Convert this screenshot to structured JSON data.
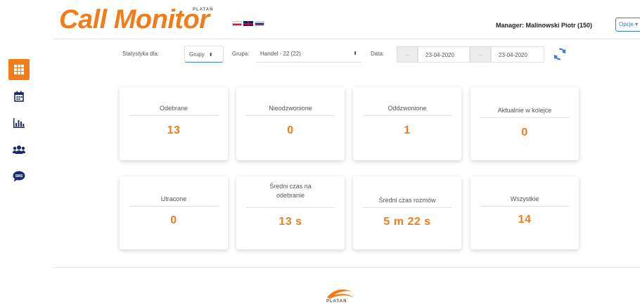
{
  "header": {
    "logo_text": "Call Monitor",
    "logo_sup": "PLATAN",
    "flags": [
      "pl-flag",
      "gb-flag",
      "ru-flag"
    ],
    "manager": "Manager: Malinowski Piotr (150)",
    "options_label": "Opcje ▾"
  },
  "filters": {
    "stats_for_label": "Statystyka dla:",
    "stats_for_value": "Grupy",
    "group_label": "Grupa:",
    "group_value": "Handel - 22 (22)",
    "date_label": "Data:",
    "date_btn": "...",
    "date_from": "23-04-2020",
    "date_to": "23-04-2020"
  },
  "sidebar": {
    "items": [
      {
        "icon": "dashboard-grid-icon",
        "active": true
      },
      {
        "icon": "calendar-icon",
        "active": false
      },
      {
        "icon": "bar-chart-icon",
        "active": false
      },
      {
        "icon": "users-icon",
        "active": false
      },
      {
        "icon": "sms-icon",
        "active": false
      }
    ]
  },
  "cards": [
    {
      "title": "Odebrane",
      "value": "13"
    },
    {
      "title": "Nieodzwonione",
      "value": "0"
    },
    {
      "title": "Oddzwonione",
      "value": "1"
    },
    {
      "title": "Aktualnie w kolejce",
      "value": "0"
    },
    {
      "title": "Utracone",
      "value": "0"
    },
    {
      "title": "Średni czas na odebranie",
      "value": "13 s"
    },
    {
      "title": "Średni czas rozmów",
      "value": "5 m 22 s"
    },
    {
      "title": "Wszystkie",
      "value": "14"
    }
  ],
  "footer": {
    "brand": "PLATAN"
  },
  "colors": {
    "accent": "#f07d1a",
    "link": "#3a7bd5"
  }
}
